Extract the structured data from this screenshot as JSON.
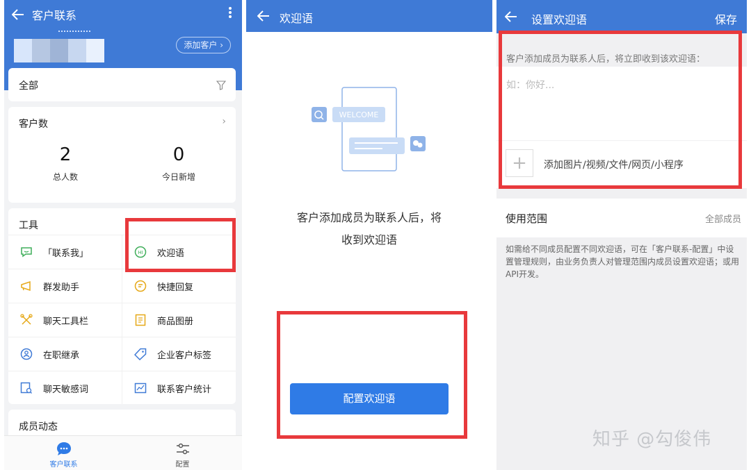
{
  "panel1": {
    "title": "客户联系",
    "add_customer_label": "添加客户 ›",
    "filter_label": "全部",
    "count_card": {
      "label": "客户数",
      "chevron": "›",
      "total_value": "2",
      "total_label": "总人数",
      "today_value": "0",
      "today_label": "今日新增"
    },
    "tools_label": "工具",
    "tools": [
      {
        "label": "「联系我」",
        "icon": "chat-bubble-icon",
        "color": "#3fae5a"
      },
      {
        "label": "欢迎语",
        "icon": "hi-bubble-icon",
        "color": "#3fae5a"
      },
      {
        "label": "群发助手",
        "icon": "megaphone-icon",
        "color": "#e6a817"
      },
      {
        "label": "快捷回复",
        "icon": "quick-reply-icon",
        "color": "#e6a817"
      },
      {
        "label": "聊天工具栏",
        "icon": "toolbar-icon",
        "color": "#e6a817"
      },
      {
        "label": "商品图册",
        "icon": "catalog-icon",
        "color": "#e6a817"
      },
      {
        "label": "在职继承",
        "icon": "transfer-icon",
        "color": "#3f7ad6"
      },
      {
        "label": "企业客户标签",
        "icon": "tag-icon",
        "color": "#3f7ad6"
      },
      {
        "label": "聊天敏感词",
        "icon": "sensitive-word-icon",
        "color": "#3f7ad6"
      },
      {
        "label": "联系客户统计",
        "icon": "stats-icon",
        "color": "#3f7ad6"
      }
    ],
    "member_activity_label": "成员动态",
    "tabs": [
      {
        "label": "客户联系",
        "active": true
      },
      {
        "label": "配置",
        "active": false
      }
    ]
  },
  "panel2": {
    "title": "欢迎语",
    "illustration_text": "WELCOME",
    "message_line1": "客户添加成员为联系人后，将",
    "message_line2": "收到欢迎语",
    "button_label": "配置欢迎语"
  },
  "panel3": {
    "title": "设置欢迎语",
    "save_label": "保存",
    "hint": "客户添加成员为联系人后，将立即收到该欢迎语：",
    "placeholder": "如：你好...",
    "attach_label": "添加图片/视频/文件/网页/小程序",
    "plus": "+",
    "range_label": "使用范围",
    "range_value": "全部成员",
    "description": "如需给不同成员配置不同欢迎语，可在「客户联系-配置」中设置管理规则，由业务负责人对管理范围内成员设置欢迎语；或用API开发。",
    "watermark": "知乎 @勾俊伟"
  },
  "colors": {
    "brand_blue": "#3f7ad6",
    "button_blue": "#2f7be6",
    "highlight_red": "#e8393c"
  }
}
